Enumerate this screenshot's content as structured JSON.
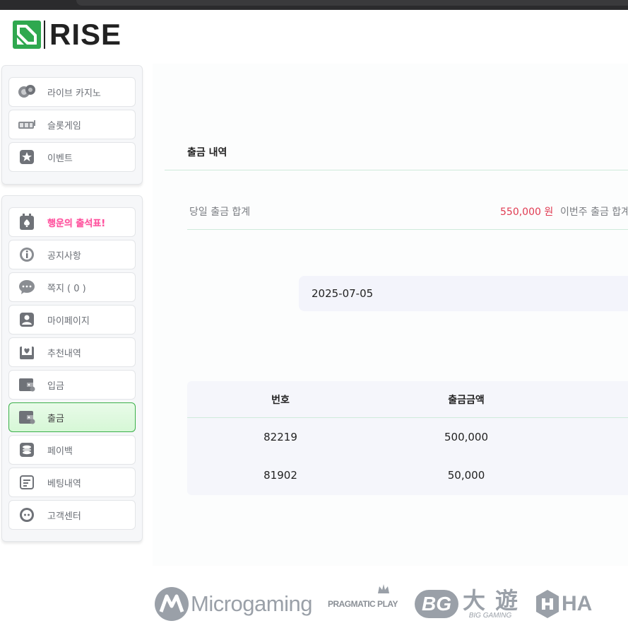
{
  "brand": {
    "name": "RISE",
    "accent": "#3cb04a"
  },
  "menu_top": [
    {
      "label": "라이브 카지노",
      "icon": "chips-icon"
    },
    {
      "label": "슬롯게임",
      "icon": "slot-machine-icon"
    },
    {
      "label": "이벤트",
      "icon": "star-icon"
    }
  ],
  "menu_main": [
    {
      "label": "행운의 출석표!",
      "icon": "calendar-spade-icon"
    },
    {
      "label": "공지사항",
      "icon": "info-icon"
    },
    {
      "label": "쪽지 ( 0 )",
      "icon": "chat-icon"
    },
    {
      "label": "마이페이지",
      "icon": "user-icon"
    },
    {
      "label": "추천내역",
      "icon": "heart-envelope-icon"
    },
    {
      "label": "입금",
      "icon": "wallet-in-icon"
    },
    {
      "label": "출금",
      "icon": "wallet-out-icon"
    },
    {
      "label": "페이백",
      "icon": "coins-icon"
    },
    {
      "label": "베팅내역",
      "icon": "list-icon"
    },
    {
      "label": "고객센터",
      "icon": "support-icon"
    }
  ],
  "page": {
    "title": "출금 내역",
    "today_label": "당일 출금 합계",
    "today_value": "550,000 원",
    "week_label": "이번주 출금 합계",
    "date": "2025-07-05"
  },
  "table": {
    "headers": [
      "번호",
      "출금금액"
    ],
    "rows": [
      [
        "82219",
        "500,000"
      ],
      [
        "81902",
        "50,000"
      ]
    ]
  },
  "partners": [
    "Microgaming",
    "PRAGMATIC PLAY",
    "BG",
    "大",
    "遊",
    "BIG GAMING",
    "HA"
  ]
}
